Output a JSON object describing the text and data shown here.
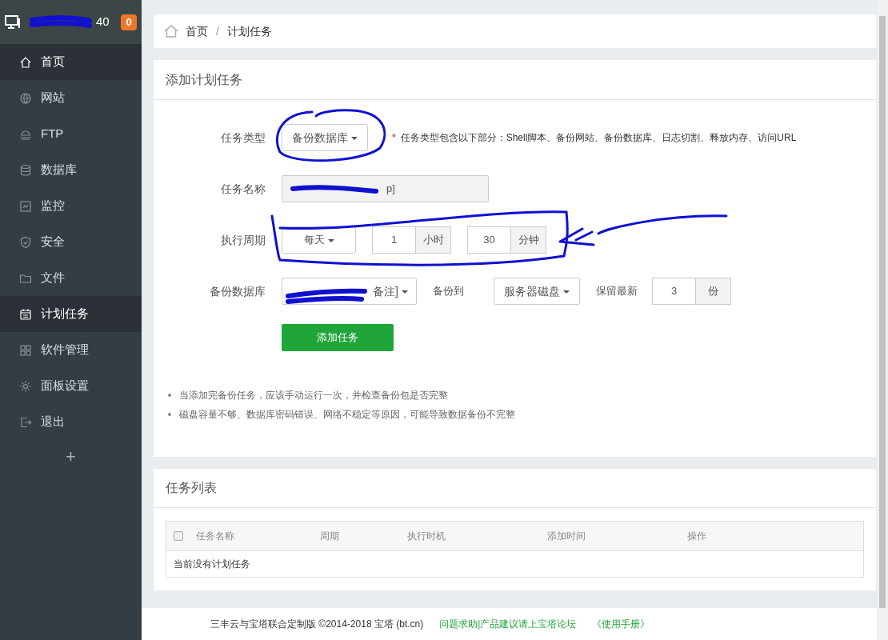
{
  "sidebar": {
    "server_name": "40",
    "badge": "0",
    "items": [
      {
        "label": "首页",
        "selected": true
      },
      {
        "label": "网站",
        "selected": false
      },
      {
        "label": "FTP",
        "selected": false
      },
      {
        "label": "数据库",
        "selected": false
      },
      {
        "label": "监控",
        "selected": false
      },
      {
        "label": "安全",
        "selected": false
      },
      {
        "label": "文件",
        "selected": false
      },
      {
        "label": "计划任务",
        "selected": true
      },
      {
        "label": "软件管理",
        "selected": false
      },
      {
        "label": "面板设置",
        "selected": false
      },
      {
        "label": "退出",
        "selected": false
      }
    ],
    "add": "+"
  },
  "breadcrumb": [
    "首页",
    "计划任务"
  ],
  "breadcrumb_sep": "/",
  "add_task": {
    "title": "添加计划任务",
    "task_type": {
      "label": "任务类型",
      "value": "备份数据库",
      "required_mark": "*",
      "hint": "任务类型包含以下部分：Shell脚本、备份网站、备份数据库、日志切割、释放内存、访问URL"
    },
    "task_name": {
      "label": "任务名称",
      "value": "p]"
    },
    "cycle": {
      "label": "执行周期",
      "period": "每天",
      "hour": "1",
      "hour_unit": "小时",
      "minute": "30",
      "minute_unit": "分钟"
    },
    "backup": {
      "label": "备份数据库",
      "database": "备注]",
      "to_label": "备份到",
      "to_value": "服务器磁盘",
      "keep_label": "保留最新",
      "keep_value": "3",
      "keep_unit": "份"
    },
    "submit": "添加任务",
    "notes": [
      "当添加完备份任务，应该手动运行一次，并检查备份包是否完整",
      "磁盘容量不够、数据库密码错误、网络不稳定等原因，可能导致数据备份不完整"
    ]
  },
  "task_list": {
    "title": "任务列表",
    "columns": [
      "任务名称",
      "周期",
      "执行时机",
      "添加时间",
      "操作"
    ],
    "select_all_checked": false,
    "empty": "当前没有计划任务"
  },
  "footer": {
    "copyright": "三丰云与宝塔联合定制版 ©2014-2018 宝塔 (bt.cn)",
    "links": [
      "问题求助|产品建议请上宝塔论坛",
      "《使用手册》"
    ]
  }
}
